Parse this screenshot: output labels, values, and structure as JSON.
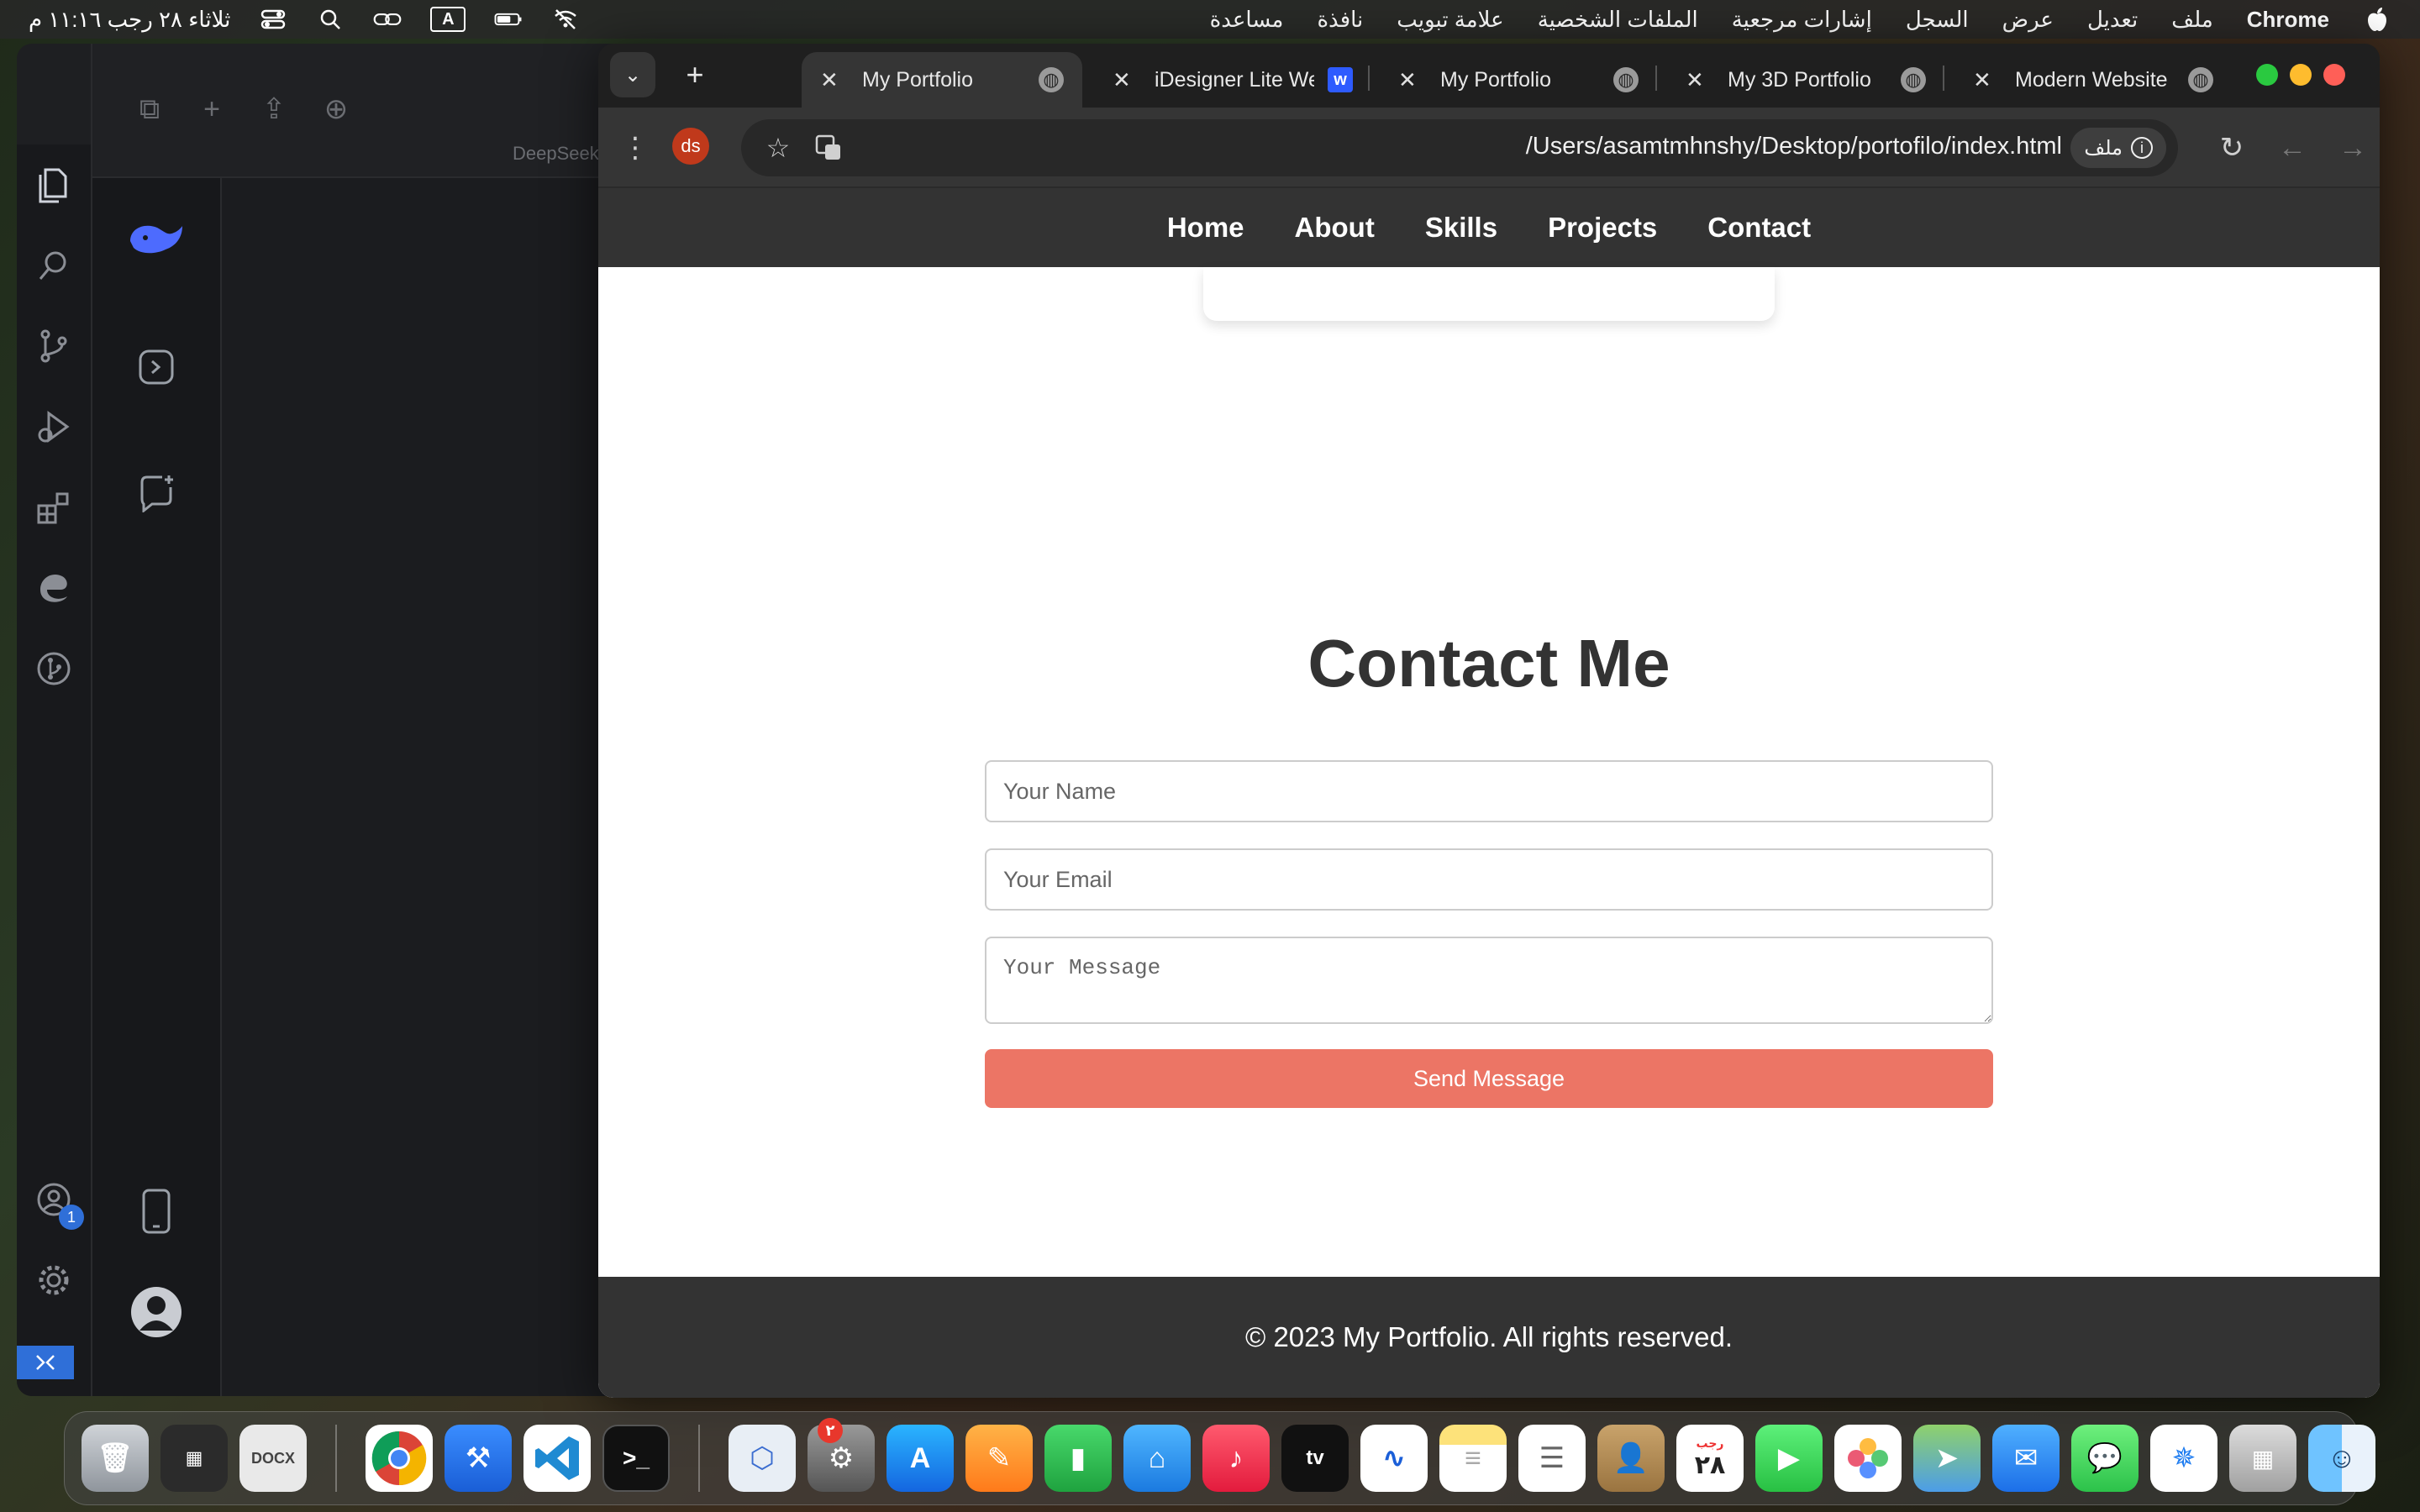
{
  "menubar": {
    "time": "ثلاثاء ٢٨ رجب ١١:١٦ م",
    "app_name": "Chrome",
    "menus": [
      "ملف",
      "تعديل",
      "عرض",
      "السجل",
      "إشارات مرجعية",
      "الملفات الشخصية",
      "علامة تبويب",
      "نافذة",
      "مساعدة"
    ],
    "input_indicator": "A"
  },
  "vscode": {
    "panel_title": "DeepSeek -",
    "notification_count": "1"
  },
  "chrome": {
    "tabs": [
      {
        "title": "My Portfolio",
        "active": true
      },
      {
        "title": "iDesigner Lite We",
        "active": false
      },
      {
        "title": "My Portfolio",
        "active": false
      },
      {
        "title": "My 3D Portfolio",
        "active": false
      },
      {
        "title": "Modern Website",
        "active": false
      }
    ],
    "url": "/Users/asamtmhnshy/Desktop/portofilo/index.html",
    "file_chip": "ملف",
    "profile_initials": "ds"
  },
  "site": {
    "nav": [
      "Home",
      "About",
      "Skills",
      "Projects",
      "Contact"
    ],
    "contact_title": "Contact Me",
    "name_placeholder": "Your Name",
    "email_placeholder": "Your Email",
    "message_placeholder": "Your Message",
    "send_label": "Send Message",
    "footer": "© 2023 My Portfolio. All rights reserved.",
    "accent_color": "#ec7565"
  },
  "dock": {
    "settings_badge": "٢",
    "calendar_month": "رجب",
    "calendar_day": "٢٨"
  }
}
